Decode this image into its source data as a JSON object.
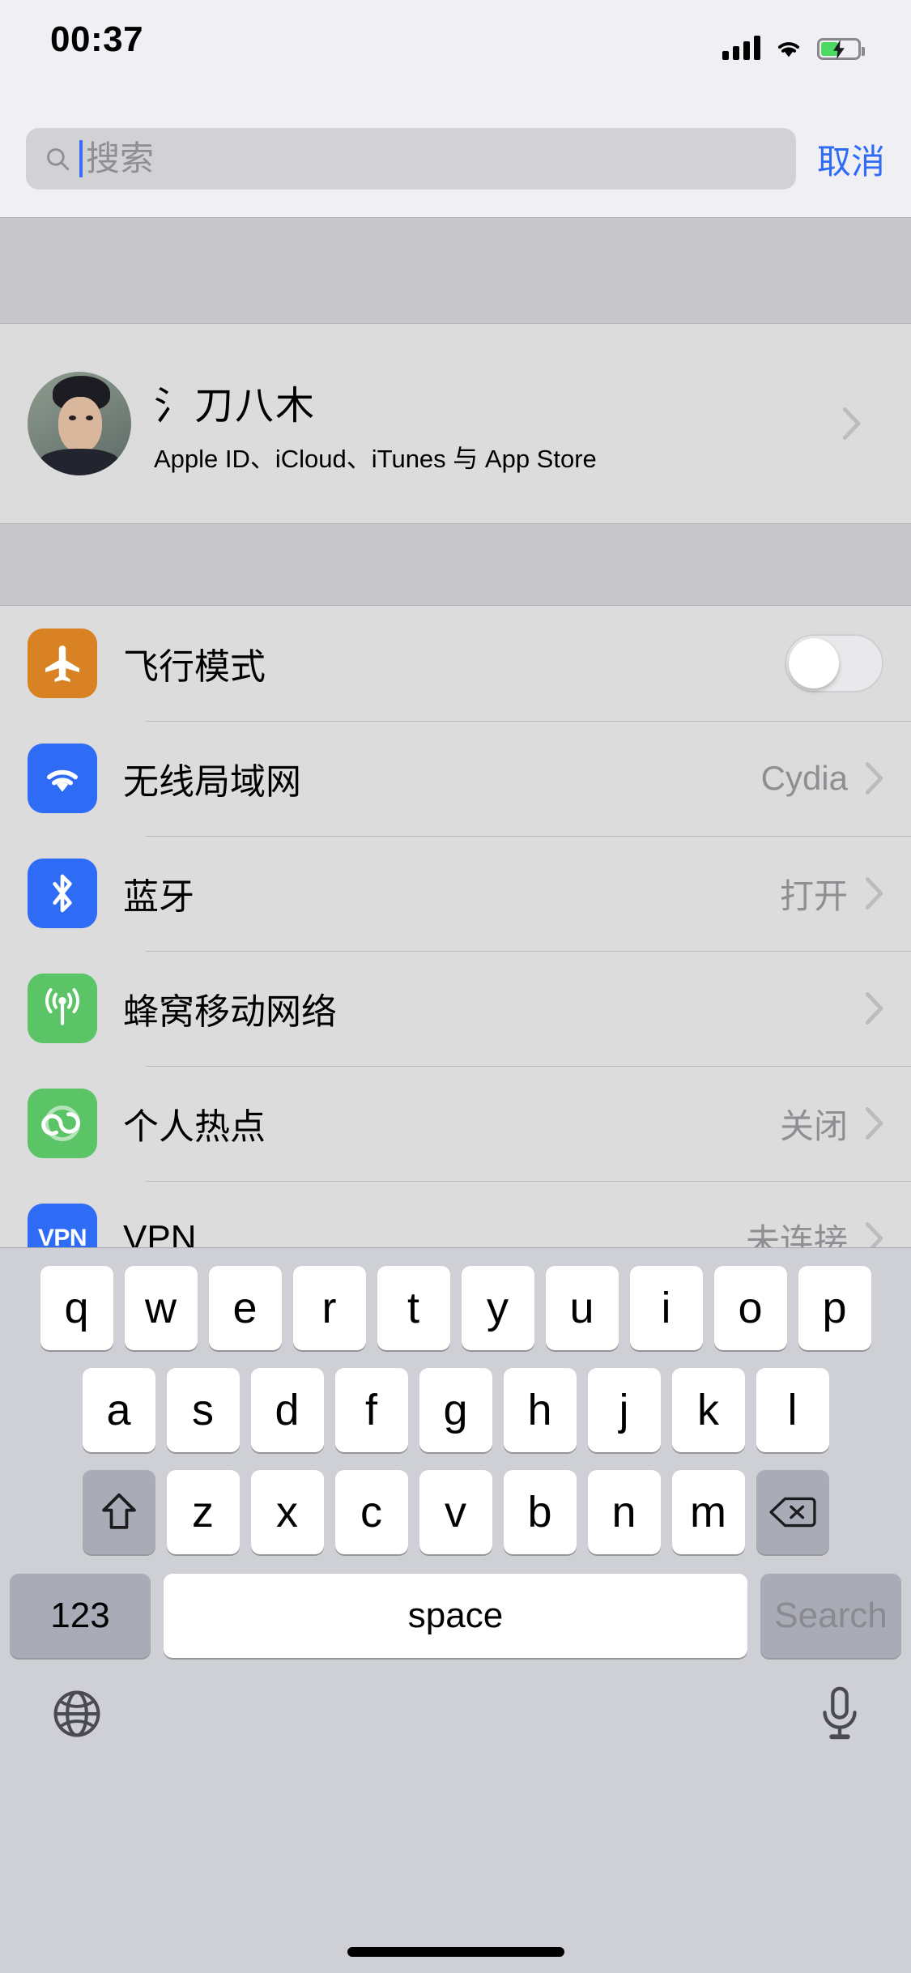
{
  "status_bar": {
    "time": "00:37",
    "signal_icon": "cellular-bars-icon",
    "wifi_icon": "wifi-icon",
    "battery_icon": "battery-charging-icon",
    "battery_level_percent": 48,
    "battery_color": "#4cd964"
  },
  "search": {
    "placeholder": "搜索",
    "value": "",
    "cancel_label": "取消",
    "accent_color": "#2f6cf6",
    "icon": "search-icon"
  },
  "profile": {
    "name": "氵刀八木",
    "subtitle": "Apple ID、iCloud、iTunes 与 App Store",
    "avatar": "user-avatar",
    "chevron": "chevron-right-icon"
  },
  "settings": [
    {
      "label": "飞行模式",
      "icon": "airplane-icon",
      "icon_color": "#d98224",
      "control": "toggle",
      "toggle_on": false,
      "value": ""
    },
    {
      "label": "无线局域网",
      "icon": "wifi-icon",
      "icon_color": "#2f6cf6",
      "control": "chevron",
      "value": "Cydia"
    },
    {
      "label": "蓝牙",
      "icon": "bluetooth-icon",
      "icon_color": "#2f6cf6",
      "control": "chevron",
      "value": "打开"
    },
    {
      "label": "蜂窝移动网络",
      "icon": "cellular-icon",
      "icon_color": "#5bc466",
      "control": "chevron",
      "value": ""
    },
    {
      "label": "个人热点",
      "icon": "hotspot-icon",
      "icon_color": "#5bc466",
      "control": "chevron",
      "value": "关闭"
    },
    {
      "label": "VPN",
      "icon": "vpn-icon",
      "icon_color": "#2f6cf6",
      "control": "chevron",
      "value": "未连接"
    }
  ],
  "keyboard": {
    "row1": [
      "q",
      "w",
      "e",
      "r",
      "t",
      "y",
      "u",
      "i",
      "o",
      "p"
    ],
    "row2": [
      "a",
      "s",
      "d",
      "f",
      "g",
      "h",
      "j",
      "k",
      "l"
    ],
    "row3": [
      "z",
      "x",
      "c",
      "v",
      "b",
      "n",
      "m"
    ],
    "shift_icon": "shift-icon",
    "backspace_icon": "backspace-icon",
    "numbers_label": "123",
    "space_label": "space",
    "return_label": "Search",
    "globe_icon": "globe-icon",
    "mic_icon": "microphone-icon"
  }
}
